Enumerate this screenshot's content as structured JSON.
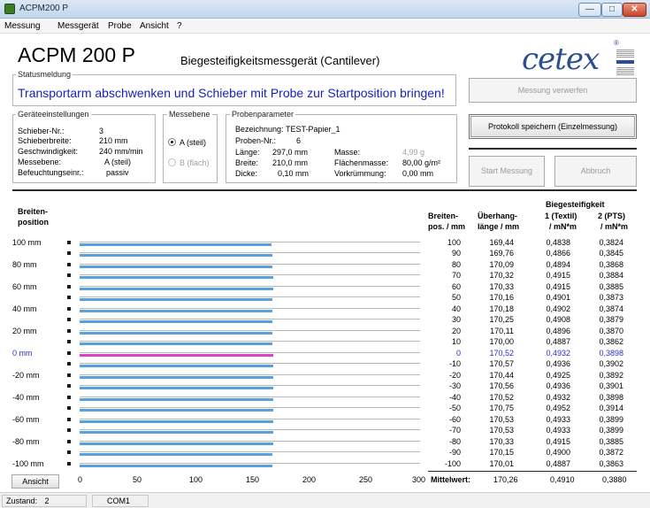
{
  "window": {
    "title": "ACPM200 P",
    "buttons": {
      "minimize": "—",
      "maximize": "□",
      "close": "✕"
    }
  },
  "menu": [
    "Messung",
    "Messgerät",
    "Probe",
    "Ansicht",
    "?"
  ],
  "header": {
    "title": "ACPM 200 P",
    "subtitle": "Biegesteifigkeitsmessgerät  (Cantilever)",
    "logo": "cetex"
  },
  "status": {
    "label": "Statusmeldung",
    "text": "Transportarm abschwenken und Schieber mit Probe zur Startposition bringen!"
  },
  "device_settings": {
    "label": "Geräteeinstellungen",
    "rows": [
      {
        "key": "Schieber-Nr.:",
        "value": "3"
      },
      {
        "key": "Schieberbreite:",
        "value": "210 mm"
      },
      {
        "key": "Geschwindigkeit:",
        "value": "240 mm/min"
      },
      {
        "key": "Messebene:",
        "value": "A (steil)"
      },
      {
        "key": "Befeuchtungseinr.:",
        "value": "passiv"
      }
    ]
  },
  "measurement_plane": {
    "label": "Messebene",
    "options": [
      {
        "label": "A (steil)",
        "checked": true,
        "disabled": false
      },
      {
        "label": "B (flach)",
        "checked": false,
        "disabled": true
      }
    ]
  },
  "sample_params": {
    "label": "Probenparameter",
    "designation_key": "Bezeichnung:",
    "designation": "TEST-Papier_1",
    "sample_no_key": "Proben-Nr.:",
    "sample_no": "6",
    "left": [
      {
        "key": "Länge:",
        "value": "297,0 mm"
      },
      {
        "key": "Breite:",
        "value": "210,0 mm"
      },
      {
        "key": "Dicke:",
        "value": "0,10 mm"
      }
    ],
    "right": [
      {
        "key": "Masse:",
        "value": "4,99 g",
        "muted": true
      },
      {
        "key": "Flächenmasse:",
        "value": "80,00 g/m²",
        "muted": false
      },
      {
        "key": "Vorkrümmung:",
        "value": "0,00 mm",
        "muted": false
      }
    ]
  },
  "buttons": {
    "discard": "Messung verwerfen",
    "save": "Protokoll speichern (Einzelmessung)",
    "start": "Start Messung",
    "abort": "Abbruch",
    "view": "Ansicht"
  },
  "chart_data": {
    "type": "bar",
    "ylabel": "Breiten-\nposition",
    "xlim": [
      0,
      300
    ],
    "xticks": [
      "0",
      "50",
      "100",
      "150",
      "200",
      "250",
      "300"
    ],
    "ytick_labels": [
      "100 mm",
      "80 mm",
      "60 mm",
      "40 mm",
      "20 mm",
      "0 mm",
      "-20 mm",
      "-40 mm",
      "-60 mm",
      "-80 mm",
      "-100 mm"
    ],
    "categories": [
      100,
      90,
      80,
      70,
      60,
      50,
      40,
      30,
      20,
      10,
      0,
      -10,
      -20,
      -30,
      -40,
      -50,
      -60,
      -70,
      -80,
      -90,
      -100
    ],
    "values": [
      169.44,
      169.76,
      170.09,
      170.32,
      170.33,
      170.16,
      170.18,
      170.25,
      170.11,
      170.0,
      170.52,
      170.57,
      170.44,
      170.56,
      170.52,
      170.75,
      170.53,
      170.53,
      170.33,
      170.15,
      170.01
    ],
    "highlight_category": 0
  },
  "table": {
    "header_group": "Biegesteifigkeit",
    "columns": [
      {
        "line1": "Breiten-",
        "line2": "pos. / mm"
      },
      {
        "line1": "Überhang-",
        "line2": "länge / mm"
      },
      {
        "line1": "1 (Textil)",
        "line2": "/ mN*m"
      },
      {
        "line1": "2 (PTS)",
        "line2": "/ mN*m"
      }
    ],
    "rows": [
      [
        "100",
        "169,44",
        "0,4838",
        "0,3824"
      ],
      [
        "90",
        "169,76",
        "0,4866",
        "0,3845"
      ],
      [
        "80",
        "170,09",
        "0,4894",
        "0,3868"
      ],
      [
        "70",
        "170,32",
        "0,4915",
        "0,3884"
      ],
      [
        "60",
        "170,33",
        "0,4915",
        "0,3885"
      ],
      [
        "50",
        "170,16",
        "0,4901",
        "0,3873"
      ],
      [
        "40",
        "170,18",
        "0,4902",
        "0,3874"
      ],
      [
        "30",
        "170,25",
        "0,4908",
        "0,3879"
      ],
      [
        "20",
        "170,11",
        "0,4896",
        "0,3870"
      ],
      [
        "10",
        "170,00",
        "0,4887",
        "0,3862"
      ],
      [
        "0",
        "170,52",
        "0,4932",
        "0,3898"
      ],
      [
        "-10",
        "170,57",
        "0,4936",
        "0,3902"
      ],
      [
        "-20",
        "170,44",
        "0,4925",
        "0,3892"
      ],
      [
        "-30",
        "170,56",
        "0,4936",
        "0,3901"
      ],
      [
        "-40",
        "170,52",
        "0,4932",
        "0,3898"
      ],
      [
        "-50",
        "170,75",
        "0,4952",
        "0,3914"
      ],
      [
        "-60",
        "170,53",
        "0,4933",
        "0,3899"
      ],
      [
        "-70",
        "170,53",
        "0,4933",
        "0,3899"
      ],
      [
        "-80",
        "170,33",
        "0,4915",
        "0,3885"
      ],
      [
        "-90",
        "170,15",
        "0,4900",
        "0,3872"
      ],
      [
        "-100",
        "170,01",
        "0,4887",
        "0,3863"
      ]
    ],
    "highlight_row": 10,
    "mean_label": "Mittelwert:",
    "mean_values": [
      "170,26",
      "0,4910",
      "0,3880"
    ]
  },
  "statusbar": {
    "state_label": "Zustand:",
    "state_value": "2",
    "port": "COM1"
  },
  "colors": {
    "bar": "#5aa0dd",
    "bar_highlight": "#e040c8",
    "status_text": "#1a22b8",
    "highlight_row_text": "#2830c0",
    "logo": "#2c4d8f"
  }
}
